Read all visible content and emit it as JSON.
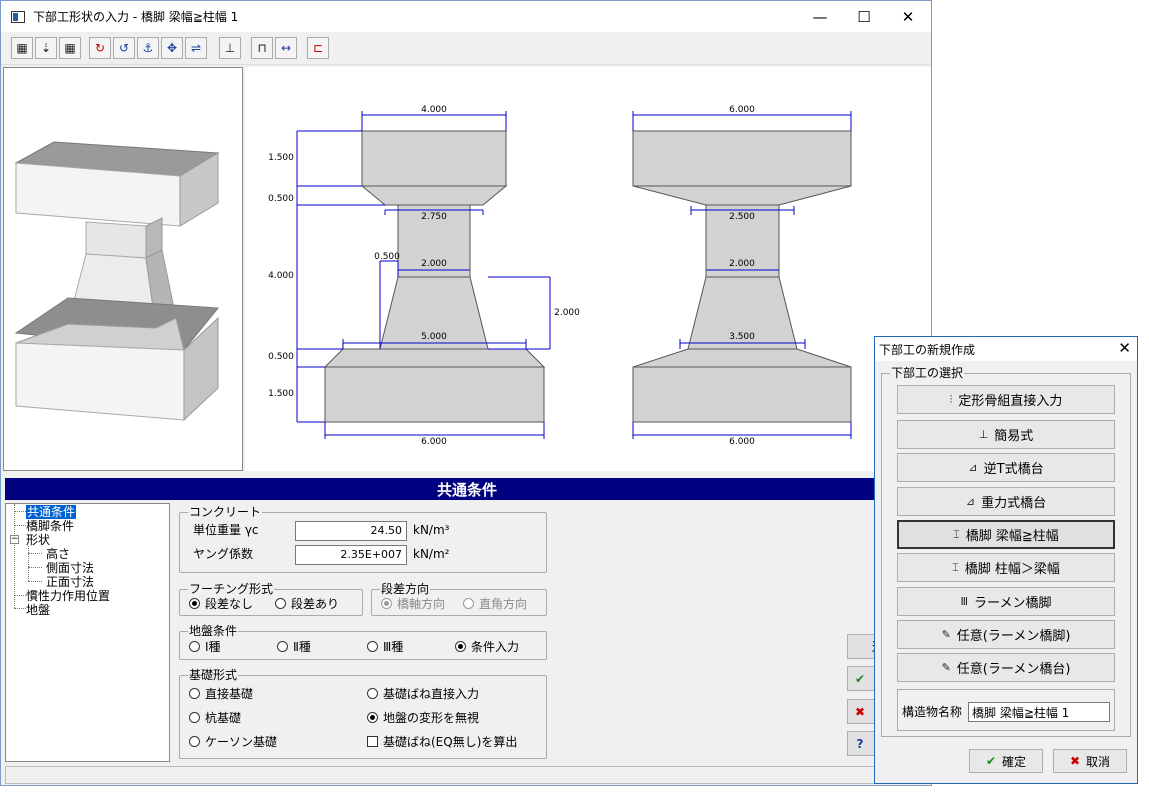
{
  "window": {
    "title": "下部工形状の入力 - 橋脚 梁幅≧柱幅 1",
    "min_glyph": "—",
    "max_glyph": "☐",
    "close_glyph": "✕"
  },
  "toolbar": {
    "icons": [
      "view-3d-icon",
      "pointer-icon",
      "view-3d-alt-icon",
      "rotate-icon",
      "rotate-alt-icon",
      "anchor-icon",
      "move-icon",
      "shift-icon",
      "pier-shape-icon",
      "front-view-icon",
      "dimension-icon",
      "section-icon"
    ]
  },
  "drawing": {
    "left": {
      "top_width": "4.000",
      "h1": "1.500",
      "h2": "0.500",
      "h3": "4.000",
      "h4": "0.500",
      "h5": "1.500",
      "col_top": "2.750",
      "col_mid": "2.000",
      "taper": "0.500",
      "col_h": "2.000",
      "col_base": "5.000",
      "foot_width": "6.000"
    },
    "right": {
      "top_width": "6.000",
      "col_top": "2.500",
      "col_mid": "2.000",
      "col_base": "3.500",
      "foot_width": "6.000"
    }
  },
  "section_header": "共通条件",
  "tree": {
    "items": [
      "共通条件",
      "橋脚条件",
      "形状",
      "高さ",
      "側面寸法",
      "正面寸法",
      "慣性力作用位置",
      "地盤"
    ]
  },
  "concrete": {
    "group": "コンクリート",
    "weight_label": "単位重量 γc",
    "weight_value": "24.50",
    "weight_unit": "kN/m³",
    "young_label": "ヤング係数",
    "young_value": "2.35E+007",
    "young_unit": "kN/m²"
  },
  "footing": {
    "group": "フーチング形式",
    "opt1": "段差なし",
    "opt2": "段差あり"
  },
  "step_dir": {
    "group": "段差方向",
    "opt1": "橋軸方向",
    "opt2": "直角方向"
  },
  "ground": {
    "group": "地盤条件",
    "opt1": "Ⅰ種",
    "opt2": "Ⅱ種",
    "opt3": "Ⅲ種",
    "opt4": "条件入力"
  },
  "foundation": {
    "group": "基礎形式",
    "opt1": "直接基礎",
    "opt2": "杭基礎",
    "opt3": "ケーソン基礎",
    "opt4": "基礎ばね直接入力",
    "opt5": "地盤の変形を無視",
    "opt6": "基礎ばね(EQ無し)を算出"
  },
  "side_buttons": {
    "b1": "送",
    "b2": "✔",
    "b3": "✖",
    "b4": "?"
  },
  "dialog": {
    "title": "下部工の新規作成",
    "close_glyph": "✕",
    "group": "下部工の選択",
    "options": [
      "定形骨組直接入力",
      "簡易式",
      "逆T式橋台",
      "重力式橋台",
      "橋脚 梁幅≧柱幅",
      "橋脚 柱幅＞梁幅",
      "ラーメン橋脚",
      "任意(ラーメン橋脚)",
      "任意(ラーメン橋台)"
    ],
    "icons": [
      "⫶",
      "⊥",
      "⊿",
      "⊿",
      "⌶",
      "⌶",
      "Ⅲ",
      "✎",
      "✎"
    ],
    "name_label": "構造物名称",
    "name_value": "橋脚 梁幅≧柱幅 1",
    "ok": "確定",
    "cancel": "取消"
  },
  "colors": {
    "accent_header": "#000080",
    "shape_fill": "#d2d2d2",
    "dim_line": "#0000cc",
    "ok_check": "#1a8a1a",
    "cancel_x": "#cc0000"
  }
}
